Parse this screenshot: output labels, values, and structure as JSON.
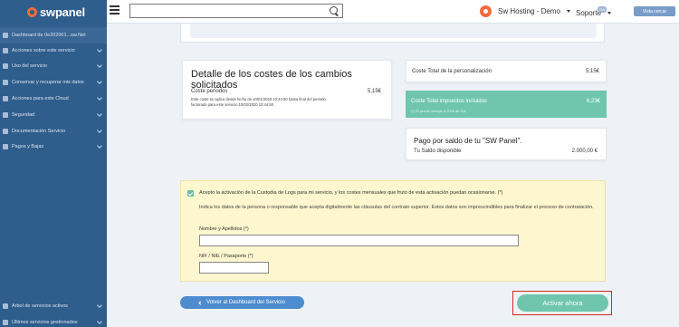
{
  "header": {
    "logo": "swpanel",
    "search_placeholder": "",
    "account_name": "Sw Hosting - Demo",
    "support_label": "Soporte",
    "support_badge": "SW",
    "clear_button": "Vista cercar"
  },
  "sidebar": {
    "items": [
      {
        "label": "Dashboard de 0e202001...sw.Net",
        "chevron": false
      },
      {
        "label": "Acciones sobre este servicio",
        "chevron": true
      },
      {
        "label": "Uso del servicio",
        "chevron": true
      },
      {
        "label": "Conservar y recuperar mis datos",
        "chevron": true
      },
      {
        "label": "Acciones para este Cloud",
        "chevron": true
      },
      {
        "label": "Seguridad",
        "chevron": true
      },
      {
        "label": "Documentación Servicio",
        "chevron": true
      },
      {
        "label": "Pagos y Bajas",
        "chevron": true
      },
      {
        "label": "Árbol de servicios activos",
        "chevron": true
      },
      {
        "label": "Últimos servicios gestionados",
        "chevron": true
      }
    ]
  },
  "detail": {
    "title": "Detalle de los costes de los cambios solicitados",
    "period_label": "Coste periodos",
    "period_value": "5,15€",
    "note_line1": "Este coste se aplica desde fecha de 10/01/2020 10:44:50 hasta final del periodo",
    "note_line2": "facturado para este servicio 10/02/2020 10:44:50"
  },
  "cost": {
    "label": "Coste Total de la personalización",
    "value": "5,15€"
  },
  "tax": {
    "label": "Coste Total impuestos incluidos",
    "value": "6,23€",
    "note": "(*) El precio incluye el 21% de IVA"
  },
  "payment": {
    "title": "Pago por saldo de tu \"SW Panel\".",
    "balance_label": "Tu Saldo disponible",
    "balance_value": "2.000,00 €"
  },
  "consent": {
    "checkbox_text": "Acepto la activación de la Custodia de Logs para mi servicio, y los costes mensuales que fruto de esta activación puedan ocasionarse. (*)",
    "instructions": "Indica los datos de la persona o responsable que acepta digitalmente las cláusulas del contrato superior. Estos datos son imprescindibles para finalizar el proceso de contratación.",
    "name_label": "Nombre y Apellidos (*)",
    "name_value": "",
    "nif_label": "NIF / NIE / Pasaporte (*)",
    "nif_value": ""
  },
  "actions": {
    "back_label": "Volver al Dashboard del Servicio",
    "activate_label": "Activar ahora"
  }
}
